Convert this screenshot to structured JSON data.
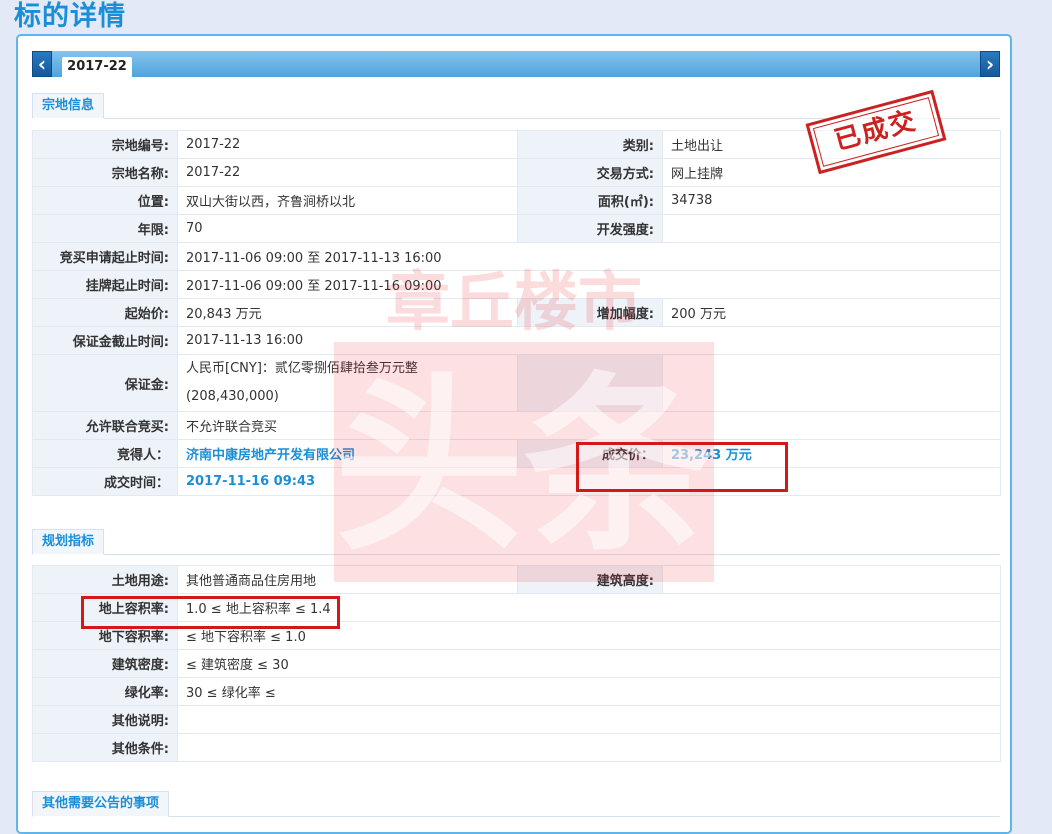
{
  "page": {
    "title": "标的详情"
  },
  "tab": {
    "label": "2017-22",
    "prev_icon": "chevron-left-icon",
    "next_icon": "chevron-right-icon"
  },
  "stamp": {
    "text": "已成交"
  },
  "watermark": {
    "text_top": "章丘楼市",
    "text_main": "头条"
  },
  "sections": {
    "zongdi": "宗地信息",
    "guihua": "规划指标",
    "qita": "其他需要公告的事项"
  },
  "zongdi": {
    "code_label": "宗地编号:",
    "code_value": "2017-22",
    "category_label": "类别:",
    "category_value": "土地出让",
    "name_label": "宗地名称:",
    "name_value": "2017-22",
    "trade_label": "交易方式:",
    "trade_value": "网上挂牌",
    "location_label": "位置:",
    "location_value": "双山大街以西，齐鲁涧桥以北",
    "area_label": "面积(㎡):",
    "area_value": "34738",
    "term_label": "年限:",
    "term_value": "70",
    "intensity_label": "开发强度:",
    "intensity_value": "",
    "apply_time_label": "竞买申请起止时间:",
    "apply_time_value": "2017-11-06 09:00 至 2017-11-13 16:00",
    "listing_time_label": "挂牌起止时间:",
    "listing_time_value": "2017-11-06 09:00 至 2017-11-16 09:00",
    "start_price_label": "起始价:",
    "start_price_value": "20,843 万元",
    "increment_label": "增加幅度:",
    "increment_value": "200 万元",
    "deposit_deadline_label": "保证金截止时间:",
    "deposit_deadline_value": "2017-11-13 16:00",
    "deposit_label": "保证金:",
    "deposit_value_line1": "人民币[CNY]：贰亿零捌佰肆拾叁万元整",
    "deposit_value_line2": "(208,430,000)",
    "joint_label": "允许联合竞买:",
    "joint_value": "不允许联合竞买",
    "winner_label": "竞得人：",
    "winner_value": "济南中康房地产开发有限公司",
    "deal_price_label": "成交价：",
    "deal_price_value": "23,243 万元",
    "deal_time_label": "成交时间：",
    "deal_time_value": "2017-11-16 09:43"
  },
  "guihua": {
    "use_label": "土地用途:",
    "use_value": "其他普通商品住房用地",
    "height_label": "建筑高度:",
    "height_value": "",
    "far_label": "地上容积率:",
    "far_value": "1.0 ≤ 地上容积率 ≤ 1.4",
    "ufar_label": "地下容积率:",
    "ufar_value": "≤ 地下容积率 ≤ 1.0",
    "density_label": "建筑密度:",
    "density_value": "≤ 建筑密度 ≤ 30",
    "green_label": "绿化率:",
    "green_value": "30 ≤ 绿化率 ≤",
    "note_label": "其他说明:",
    "note_value": "",
    "cond_label": "其他条件:",
    "cond_value": ""
  },
  "colors": {
    "accent": "#1a8fd8",
    "label_bg": "#eef3f9",
    "highlight": "#d41818",
    "page_bg": "#e3e9f7"
  }
}
